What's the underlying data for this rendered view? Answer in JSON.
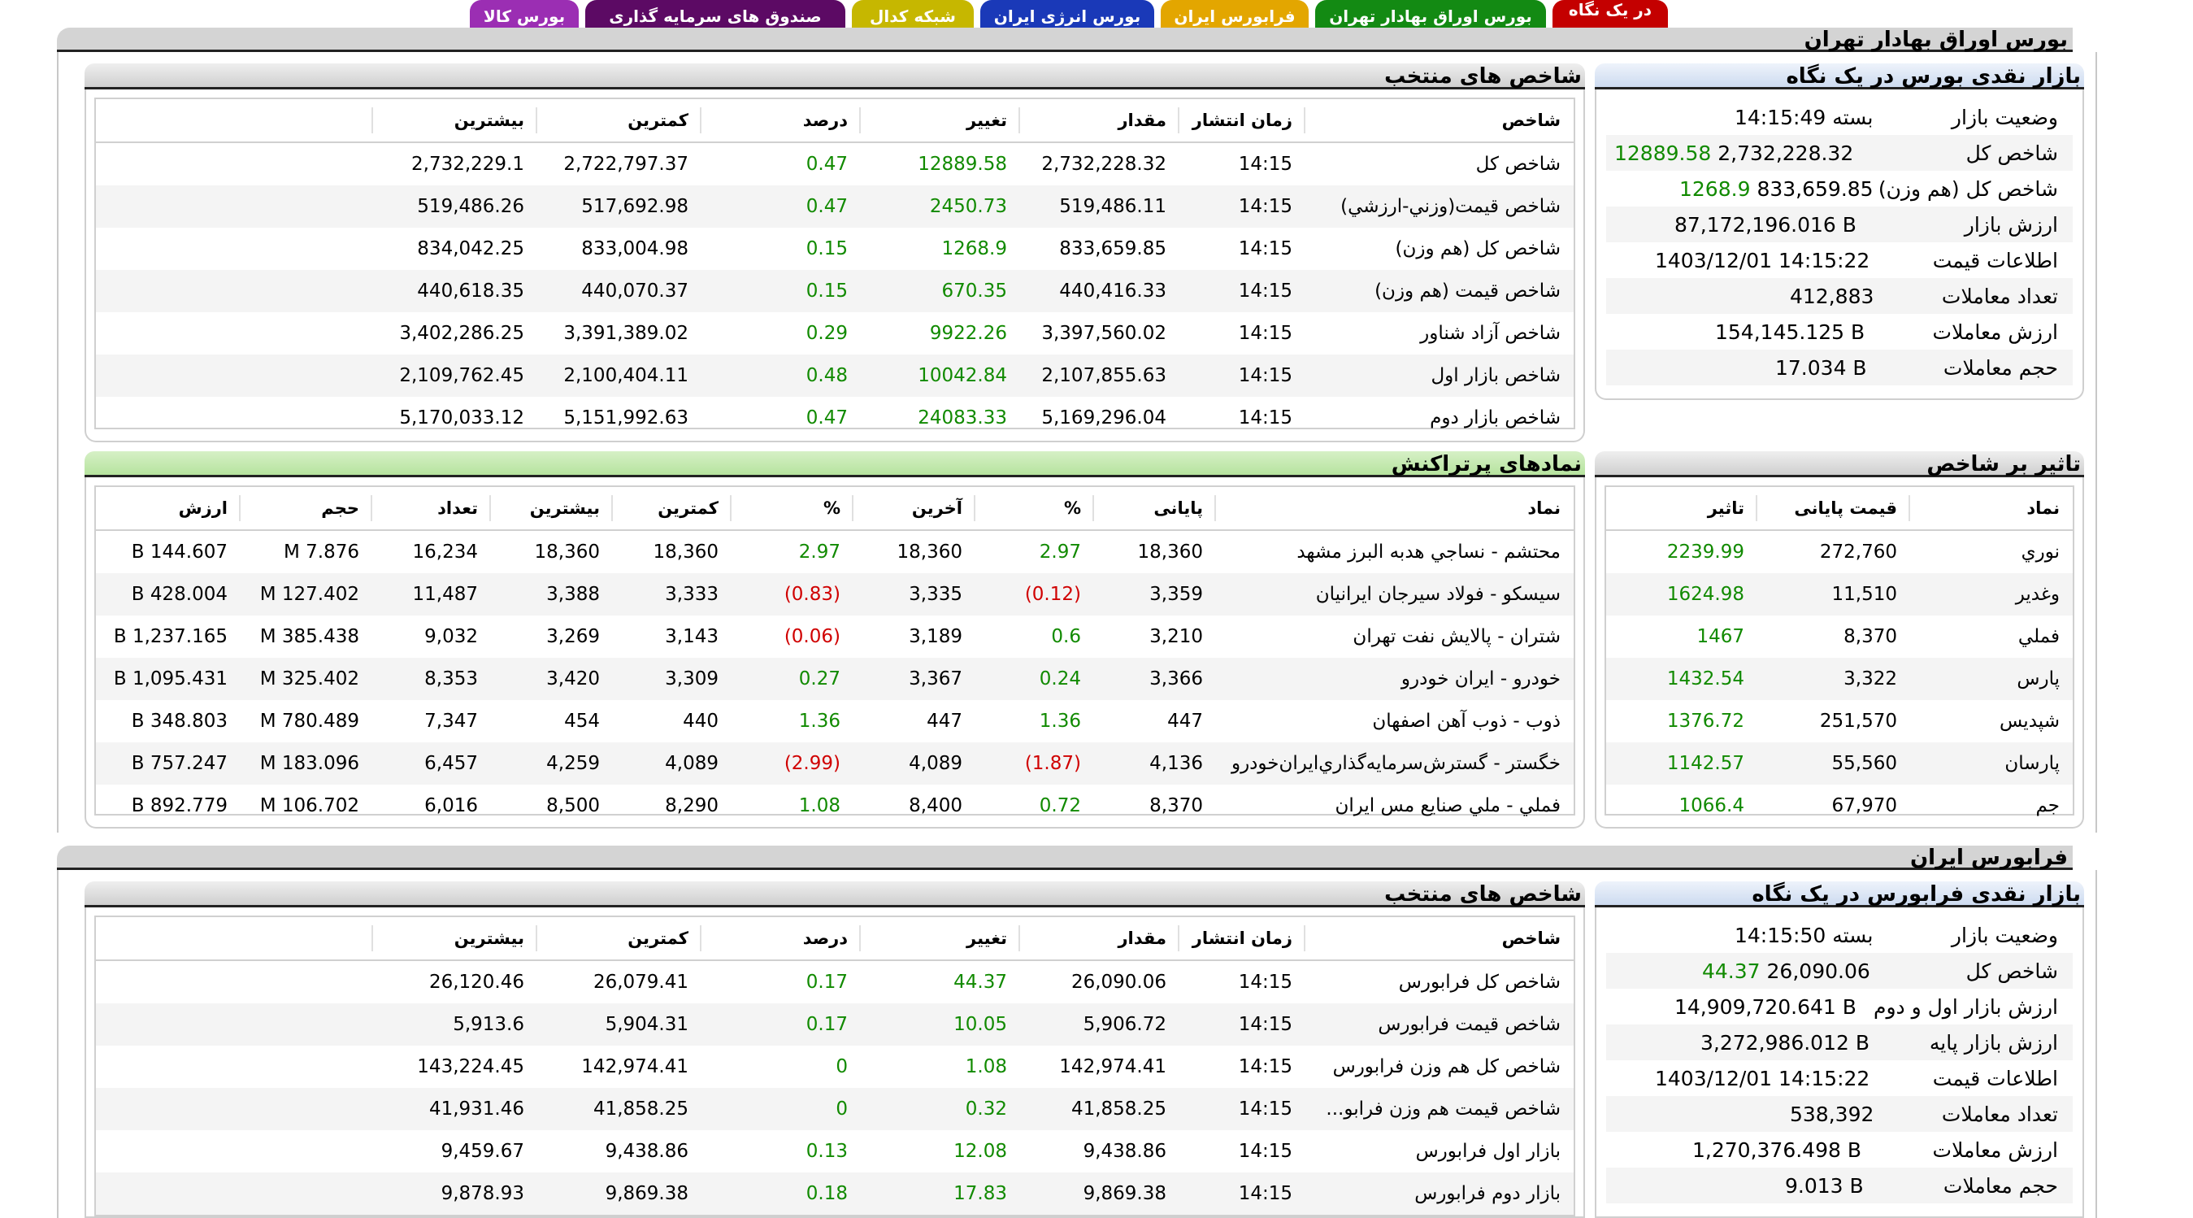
{
  "tabs": [
    {
      "label": "در یک نگاه",
      "color": "#c40000"
    },
    {
      "label": "بورس اوراق بهادار تهران",
      "color": "#138a13"
    },
    {
      "label": "فرابورس ایران",
      "color": "#e3a600"
    },
    {
      "label": "بورس انرژی ایران",
      "color": "#1a39b8"
    },
    {
      "label": "شبکه کدال",
      "color": "#c6b700"
    },
    {
      "label": "صندوق های سرمایه گذاری",
      "color": "#5c0a64"
    },
    {
      "label": "بورس کالا",
      "color": "#9b2eb3"
    }
  ],
  "tehran": {
    "section_title": "بورس اوراق بهادار تهران",
    "market": {
      "title": "بازار نقدی بورس در یک نگاه",
      "rows": [
        {
          "label": "وضعیت بازار",
          "value": "بسته 14:15:49"
        },
        {
          "label": "شاخص کل",
          "value": "2,732,228.32",
          "change": "12889.58"
        },
        {
          "label": "شاخص کل (هم وزن)",
          "value": "833,659.85",
          "change": "1268.9"
        },
        {
          "label": "ارزش بازار",
          "value": "87,172,196.016 B"
        },
        {
          "label": "اطلاعات قیمت",
          "value": "1403/12/01 14:15:22"
        },
        {
          "label": "تعداد معاملات",
          "value": "412,883"
        },
        {
          "label": "ارزش معاملات",
          "value": "154,145.125 B"
        },
        {
          "label": "حجم معاملات",
          "value": "17.034 B"
        }
      ]
    },
    "indices": {
      "title": "شاخص های منتخب",
      "headers": [
        "شاخص",
        "زمان انتشار",
        "مقدار",
        "تغییر",
        "درصد",
        "کمترین",
        "بیشترین",
        ""
      ],
      "rows": [
        [
          "شاخص كل",
          "14:15",
          "2,732,228.32",
          "12889.58",
          "0.47",
          "2,722,797.37",
          "2,732,229.1"
        ],
        [
          "شاخص قيمت(وزني-ارزشي)",
          "14:15",
          "519,486.11",
          "2450.73",
          "0.47",
          "517,692.98",
          "519,486.26"
        ],
        [
          "شاخص كل (هم وزن)",
          "14:15",
          "833,659.85",
          "1268.9",
          "0.15",
          "833,004.98",
          "834,042.25"
        ],
        [
          "شاخص قيمت (هم وزن)",
          "14:15",
          "440,416.33",
          "670.35",
          "0.15",
          "440,070.37",
          "440,618.35"
        ],
        [
          "شاخص آزاد شناور",
          "14:15",
          "3,397,560.02",
          "9922.26",
          "0.29",
          "3,391,389.02",
          "3,402,286.25"
        ],
        [
          "شاخص بازار اول",
          "14:15",
          "2,107,855.63",
          "10042.84",
          "0.48",
          "2,100,404.11",
          "2,109,762.45"
        ],
        [
          "شاخص بازار دوم",
          "14:15",
          "5,169,296.04",
          "24083.33",
          "0.47",
          "5,151,992.63",
          "5,170,033.12"
        ]
      ]
    },
    "impact": {
      "title": "تاثیر بر شاخص",
      "headers": [
        "نماد",
        "قیمت پایانی",
        "تاثیر"
      ],
      "rows": [
        [
          "نوري",
          "272,760",
          "2239.99"
        ],
        [
          "وغدير",
          "11,510",
          "1624.98"
        ],
        [
          "فملي",
          "8,370",
          "1467"
        ],
        [
          "پارس",
          "3,322",
          "1432.54"
        ],
        [
          "شپديس",
          "251,570",
          "1376.72"
        ],
        [
          "پارسان",
          "55,560",
          "1142.57"
        ],
        [
          "جم",
          "67,970",
          "1066.4"
        ]
      ]
    },
    "active": {
      "title": "نمادهای پرتراکنش",
      "headers": [
        "نماد",
        "پایانی",
        "%",
        "آخرین",
        "%",
        "کمترین",
        "بیشترین",
        "تعداد",
        "حجم",
        "ارزش"
      ],
      "rows": [
        [
          "محتشم - نساجي هدبه البرز مشهد",
          "18,360",
          "2.97",
          "18,360",
          "2.97",
          "18,360",
          "18,360",
          "16,234",
          "7.876 M",
          "144.607 B"
        ],
        [
          "سيسكو - فولاد سيرجان ايرانيان",
          "3,359",
          "(0.12)",
          "3,335",
          "(0.83)",
          "3,333",
          "3,388",
          "11,487",
          "127.402 M",
          "428.004 B"
        ],
        [
          "شتران - پالايش نفت تهران",
          "3,210",
          "0.6",
          "3,189",
          "(0.06)",
          "3,143",
          "3,269",
          "9,032",
          "385.438 M",
          "1,237.165 B"
        ],
        [
          "خودرو - ايران خودرو",
          "3,366",
          "0.24",
          "3,367",
          "0.27",
          "3,309",
          "3,420",
          "8,353",
          "325.402 M",
          "1,095.431 B"
        ],
        [
          "ذوب - ذوب آهن اصفهان",
          "447",
          "1.36",
          "447",
          "1.36",
          "440",
          "454",
          "7,347",
          "780.489 M",
          "348.803 B"
        ],
        [
          "خگستر - گسترش‌سرمايه‌گذاري‌ايران‌خودرو",
          "4,136",
          "(1.87)",
          "4,089",
          "(2.99)",
          "4,089",
          "4,259",
          "6,457",
          "183.096 M",
          "757.247 B"
        ],
        [
          "فملي - ملي صنايع مس ايران",
          "8,370",
          "0.72",
          "8,400",
          "1.08",
          "8,290",
          "8,500",
          "6,016",
          "106.702 M",
          "892.779 B"
        ]
      ]
    }
  },
  "farabourse": {
    "section_title": "فرابورس ایران",
    "market": {
      "title": "بازار نقدی فرابورس در یک نگاه",
      "rows": [
        {
          "label": "وضعیت بازار",
          "value": "بسته 14:15:50"
        },
        {
          "label": "شاخص کل",
          "value": "26,090.06",
          "change": "44.37"
        },
        {
          "label": "ارزش بازار اول و دوم",
          "value": "14,909,720.641 B"
        },
        {
          "label": "ارزش بازار پایه",
          "value": "3,272,986.012 B"
        },
        {
          "label": "اطلاعات قیمت",
          "value": "1403/12/01 14:15:22"
        },
        {
          "label": "تعداد معاملات",
          "value": "538,392"
        },
        {
          "label": "ارزش معاملات",
          "value": "1,270,376.498 B"
        },
        {
          "label": "حجم معاملات",
          "value": "9.013 B"
        }
      ]
    },
    "indices": {
      "title": "شاخص های منتخب",
      "headers": [
        "شاخص",
        "زمان انتشار",
        "مقدار",
        "تغییر",
        "درصد",
        "کمترین",
        "بیشترین",
        ""
      ],
      "rows": [
        [
          "شاخص كل فرابورس",
          "14:15",
          "26,090.06",
          "44.37",
          "0.17",
          "26,079.41",
          "26,120.46"
        ],
        [
          "شاخص قيمت فرابورس",
          "14:15",
          "5,906.72",
          "10.05",
          "0.17",
          "5,904.31",
          "5,913.6"
        ],
        [
          "شاخص كل هم وزن فرابورس",
          "14:15",
          "142,974.41",
          "1.08",
          "0",
          "142,974.41",
          "143,224.45"
        ],
        [
          "شاخص قيمت هم وزن فرابو...",
          "14:15",
          "41,858.25",
          "0.32",
          "0",
          "41,858.25",
          "41,931.46"
        ],
        [
          "بازار اول فرابورس",
          "14:15",
          "9,438.86",
          "12.08",
          "0.13",
          "9,438.86",
          "9,459.67"
        ],
        [
          "بازار دوم فرابورس",
          "14:15",
          "9,869.38",
          "17.83",
          "0.18",
          "9,869.38",
          "9,878.93"
        ]
      ]
    }
  }
}
